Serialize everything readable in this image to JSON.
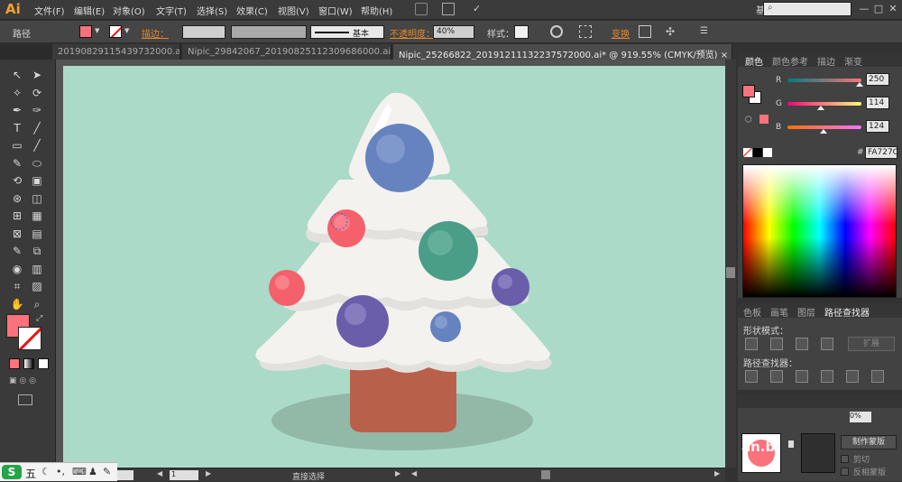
{
  "app": {
    "logo": "Ai"
  },
  "menu": [
    "文件(F)",
    "编辑(E)",
    "对象(O)",
    "文字(T)",
    "选择(S)",
    "效果(C)",
    "视图(V)",
    "窗口(W)",
    "帮助(H)"
  ],
  "workspace": "基本功能",
  "search_placeholder": "",
  "control": {
    "selection_label": "路径",
    "stroke_label": "描边：",
    "brush_label": "基本",
    "opacity_label": "不透明度：",
    "opacity_value": "40%",
    "style_label": "样式：",
    "transform_label": "变换"
  },
  "tabs": [
    {
      "label": "20190829115439732000.ai*",
      "active": false
    },
    {
      "label": "Nipic_29842067_20190825112309686000.ai*",
      "active": false
    },
    {
      "label": "Nipic_25266822_20191211132237572000.ai* @ 919.55% (CMYK/预览)",
      "active": true
    }
  ],
  "color_panel": {
    "tabs": [
      "颜色",
      "颜色参考",
      "描边",
      "渐变"
    ],
    "r_label": "R",
    "g_label": "G",
    "b_label": "B",
    "r": "250",
    "g": "114",
    "b": "124",
    "r_frac": 0.98,
    "g_frac": 0.447,
    "b_frac": 0.486,
    "hex": "FA727C",
    "fill_color": "#fa727c"
  },
  "pathfinder_panel": {
    "tabs": [
      "色板",
      "画笔",
      "图层",
      "路径查找器"
    ],
    "shape_modes_label": "形状模式：",
    "expand_label": "扩展",
    "pathfinders_label": "路径查找器："
  },
  "transparency_panel": {
    "make_mask_label": "制作蒙版",
    "clip_label": "剪切",
    "invert_label": "反相蒙版",
    "opacity_value": "0%"
  },
  "status": {
    "zoom": "",
    "page": "1",
    "tool": "直接选择"
  },
  "watermark": "an.b",
  "taskbar": {
    "ime": "五"
  },
  "colors": {
    "artboard": "#abdac8",
    "trunk": "#b9604a",
    "snow": "#f4f2ef",
    "shadow": "#92b8a8",
    "ornament_blue": "#6683bf",
    "ornament_red": "#f4606b",
    "ornament_green": "#4a9e87",
    "ornament_purple": "#6a5eab"
  }
}
